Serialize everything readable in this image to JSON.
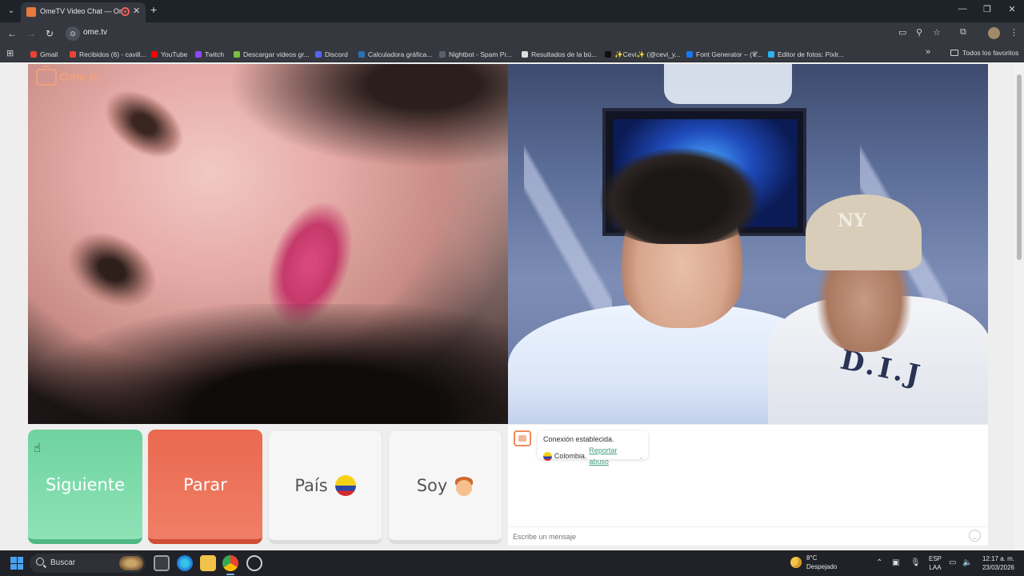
{
  "browser": {
    "tab_title": "OmeTV Video Chat — Ome",
    "tab_close": "✕",
    "new_tab": "+",
    "url": "ome.tv",
    "window_controls": {
      "minimize": "—",
      "restore": "❐",
      "close": "✕"
    },
    "bookmarks": [
      {
        "label": "Gmail",
        "color": "#ea4335"
      },
      {
        "label": "Recibidos (6) - cavill...",
        "color": "#ea4335"
      },
      {
        "label": "YouTube",
        "color": "#ff0000"
      },
      {
        "label": "Twitch",
        "color": "#9146ff"
      },
      {
        "label": "Descargar videos gr...",
        "color": "#7ac143"
      },
      {
        "label": "Discord",
        "color": "#5865f2"
      },
      {
        "label": "Calculadora gráfica...",
        "color": "#2d70b3"
      },
      {
        "label": "Nightbot - Spam Pr...",
        "color": "#5a5f6e"
      },
      {
        "label": "Resultados de la bú...",
        "color": "#dddddd"
      },
      {
        "label": "✨Cevi✨ (@cevi_y...",
        "color": "#111111"
      },
      {
        "label": "Font Generator – (𝓒...",
        "color": "#1877f2"
      },
      {
        "label": "Editor de fotos: Pixlr...",
        "color": "#2bb3f0"
      }
    ],
    "all_bookmarks": "Todos los favoritos"
  },
  "page": {
    "logo_text": "Ome.tv",
    "buttons": {
      "next": "Siguiente",
      "stop": "Parar",
      "country": "País",
      "i_am": "Soy"
    },
    "chat": {
      "status": "Conexión establecida.",
      "country": "Colombia.",
      "report": "Reportar abuso",
      "report_suffix": ".",
      "placeholder": "Escribe un mensaje"
    },
    "local_video": {
      "cap_logo": "NY",
      "shirt_print": "D.I.J"
    }
  },
  "taskbar": {
    "search_placeholder": "Buscar",
    "weather_temp": "8°C",
    "weather_desc": "Despejado",
    "lang_line1": "ESP",
    "lang_line2": "LAA",
    "time": "12:17 a. m.",
    "date": "23/03/2026"
  },
  "colors": {
    "next_button": "#6fd3a0",
    "stop_button": "#e9694f",
    "brand_orange": "#f08a5d",
    "link_green": "#3da07a"
  }
}
